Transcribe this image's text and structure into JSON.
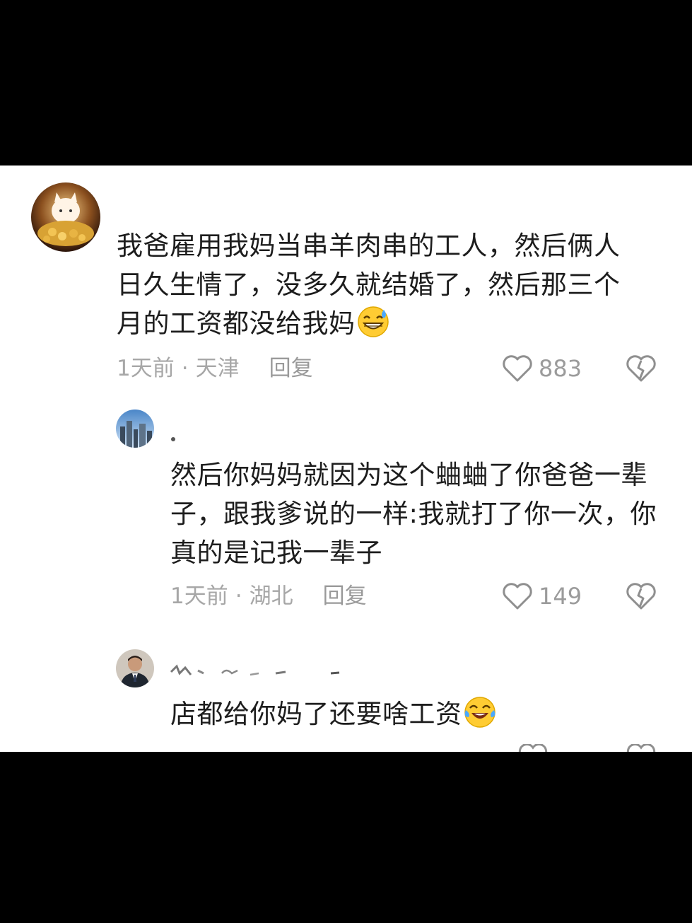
{
  "comments": [
    {
      "avatar": "golden-cat-avatar",
      "text": "我爸雇用我妈当串羊肉串的工人，然后俩人日久生情了，没多久就结婚了，然后那三个月的工资都没给我妈",
      "emoji": "grinning-sweat-emoji",
      "time": "1天前",
      "separator": "·",
      "location": "天津",
      "reply_label": "回复",
      "likes": "883"
    },
    {
      "avatar": "city-skyline-avatar",
      "text": "然后你妈妈就因为这个蛐蛐了你爸爸一辈子，跟我爹说的一样:我就打了你一次，你真的是记我一辈子",
      "time": "1天前",
      "separator": "·",
      "location": "湖北",
      "reply_label": "回复",
      "likes": "149"
    },
    {
      "avatar": "man-in-suit-avatar",
      "text": "店都给你妈了还要啥工资",
      "emoji": "laughing-tears-emoji"
    }
  ],
  "icons": {
    "like": "heart-outline-icon",
    "dislike": "broken-heart-icon"
  },
  "colors": {
    "text": "#1d1d1d",
    "meta": "#a7a7a7",
    "background": "#ffffff",
    "frame": "#000000"
  }
}
